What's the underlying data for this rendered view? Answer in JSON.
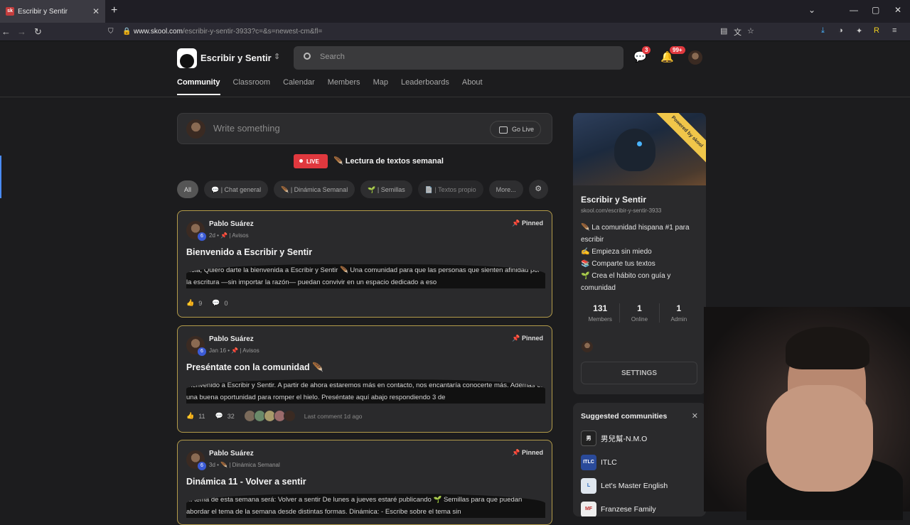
{
  "browser": {
    "tab_title": "Escribir y Sentir",
    "url_domain": "www.skool.com",
    "url_path": "/escribir-y-sentir-3933?c=&s=newest-cm&fl="
  },
  "header": {
    "community_name": "Escribir y Sentir",
    "search_placeholder": "Search",
    "chat_badge": "3",
    "notif_badge": "99+"
  },
  "nav": {
    "tabs": [
      "Community",
      "Classroom",
      "Calendar",
      "Members",
      "Map",
      "Leaderboards",
      "About"
    ],
    "active": "Community"
  },
  "composer": {
    "placeholder": "Write something",
    "go_live": "Go Live"
  },
  "live": {
    "badge": "LIVE",
    "title": "Lectura de textos semanal"
  },
  "chips": [
    "All",
    "💬 | Chat general",
    "🪶 | Dinámica Semanal",
    "🌱 | Semillas",
    "📄 | Textos propio",
    "More...",
    ""
  ],
  "posts": [
    {
      "author": "Pablo Suárez",
      "level": "6",
      "meta": "2d • 📌 | Avisos",
      "pinned": "Pinned",
      "title": "Bienvenido a Escribir y Sentir",
      "body": "Hola, Quiero darte la bienvenida a Escribir y Sentir 🪶 Una comunidad para que las personas que sienten afinidad por la escritura —sin importar la razón— puedan convivir en un espacio dedicado a eso",
      "likes": "9",
      "comments": "0",
      "last_comment": ""
    },
    {
      "author": "Pablo Suárez",
      "level": "6",
      "meta": "Jan 16 • 📌 | Avisos",
      "pinned": "Pinned",
      "title": "Preséntate con la comunidad 🪶",
      "body": "Bienvenido a Escribir y Sentir. A partir de ahora estaremos más en contacto, nos encantaría conocerte más. Además es una buena oportunidad para romper el hielo. Preséntate aquí abajo respondiendo 3 de",
      "likes": "11",
      "comments": "32",
      "last_comment": "Last comment 1d ago"
    },
    {
      "author": "Pablo Suárez",
      "level": "6",
      "meta": "3d • 🪶 | Dinámica Semanal",
      "pinned": "Pinned",
      "title": "Dinámica 11 - Volver a sentir",
      "body": "El tema de esta semana será: Volver a sentir De lunes a jueves estaré publicando 🌱 Semillas para que puedan abordar el tema de la semana desde distintas formas. Dinámica: - Escribe sobre el tema sin",
      "likes": "",
      "comments": "",
      "last_comment": ""
    }
  ],
  "sidebar": {
    "badge": "Powered by skool",
    "name": "Escribir y Sentir",
    "url": "skool.com/escribir-y-sentir-3933",
    "desc": [
      "🪶 La comunidad hispana #1 para escribir",
      "✍️ Empieza sin miedo",
      "📚 Comparte tus textos",
      "🌱 Crea el hábito con guía y comunidad"
    ],
    "stats": [
      {
        "n": "131",
        "l": "Members"
      },
      {
        "n": "1",
        "l": "Online"
      },
      {
        "n": "1",
        "l": "Admin"
      }
    ],
    "settings": "SETTINGS"
  },
  "suggested": {
    "heading": "Suggested communities",
    "items": [
      {
        "name": "男兒幫-N.M.O",
        "icon": "男"
      },
      {
        "name": "ITLC",
        "icon": "ITLC"
      },
      {
        "name": "Let's Master English",
        "icon": "L"
      },
      {
        "name": "Franzese Family",
        "icon": "MF"
      }
    ]
  }
}
